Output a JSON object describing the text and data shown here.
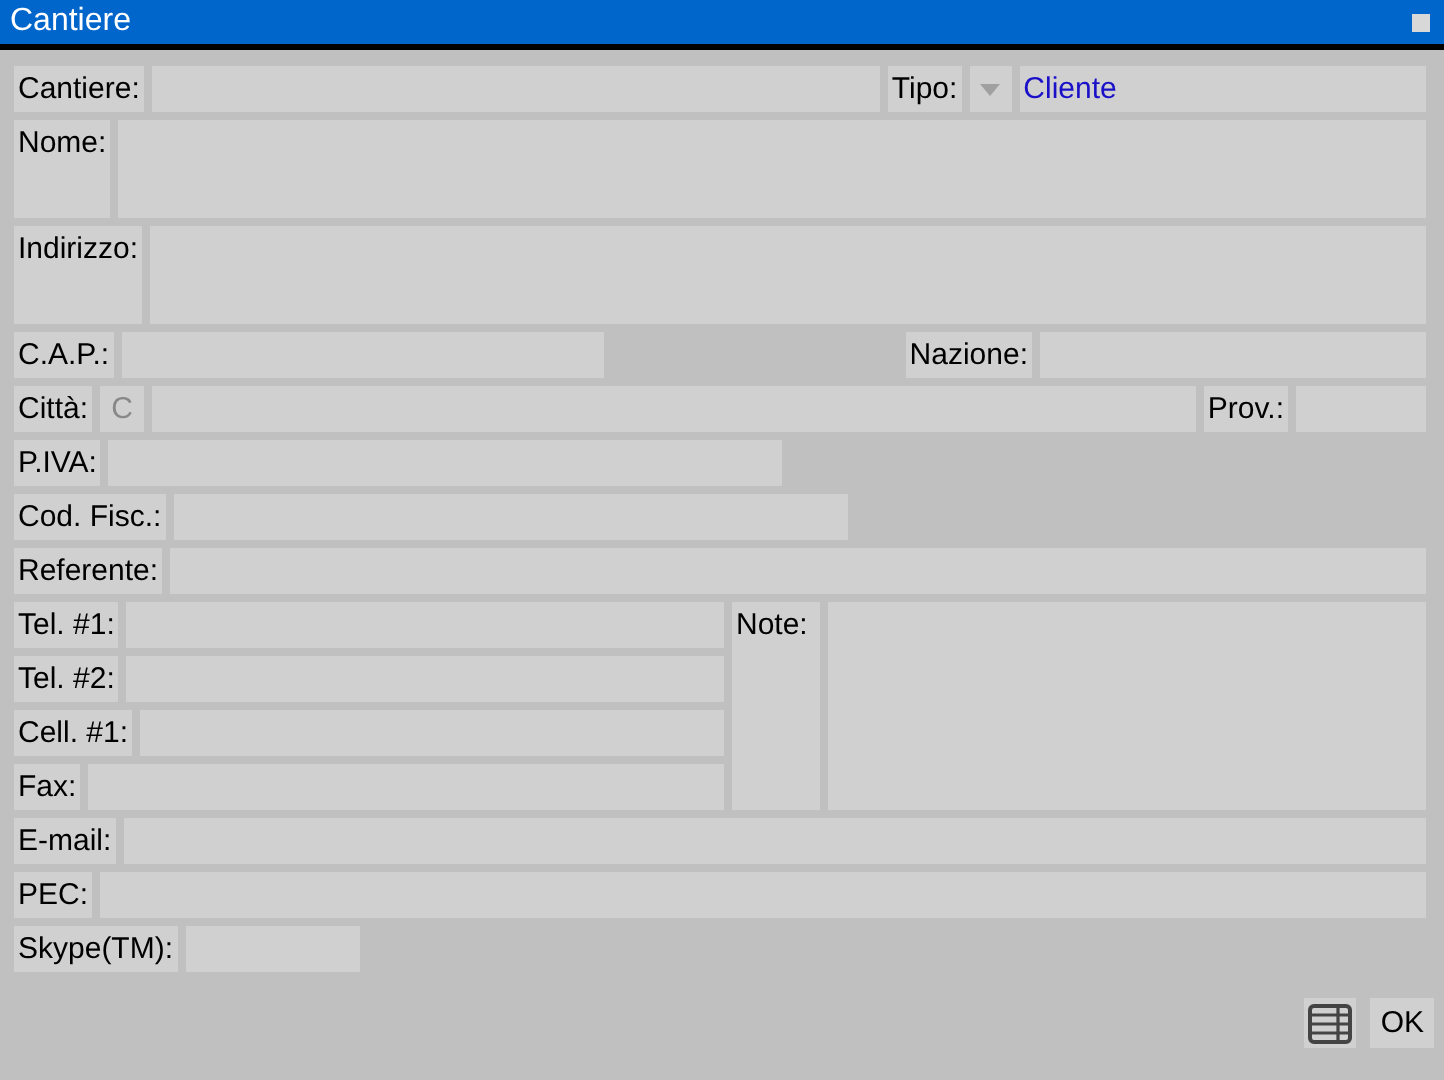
{
  "window": {
    "title": "Cantiere"
  },
  "cantiere": {
    "label": "Cantiere:"
  },
  "tipo": {
    "label": "Tipo:",
    "value": "Cliente"
  },
  "nome": {
    "label": "Nome:"
  },
  "indirizzo": {
    "label": "Indirizzo:"
  },
  "cap": {
    "label": "C.A.P.:"
  },
  "nazione": {
    "label": "Nazione:"
  },
  "citta": {
    "label": "Città:",
    "button": "C"
  },
  "prov": {
    "label": "Prov.:"
  },
  "piva": {
    "label": "P.IVA:"
  },
  "codfisc": {
    "label": "Cod. Fisc.:"
  },
  "referente": {
    "label": "Referente:"
  },
  "phones": [
    {
      "label": "Tel. #1:"
    },
    {
      "label": "Tel. #2:"
    },
    {
      "label": "Cell. #1:"
    },
    {
      "label": "Fax:"
    }
  ],
  "note": {
    "label": "Note:"
  },
  "email": {
    "label": "E-mail:"
  },
  "pec": {
    "label": "PEC:"
  },
  "skype": {
    "label": "Skype(TM):"
  },
  "ok_button": "OK"
}
